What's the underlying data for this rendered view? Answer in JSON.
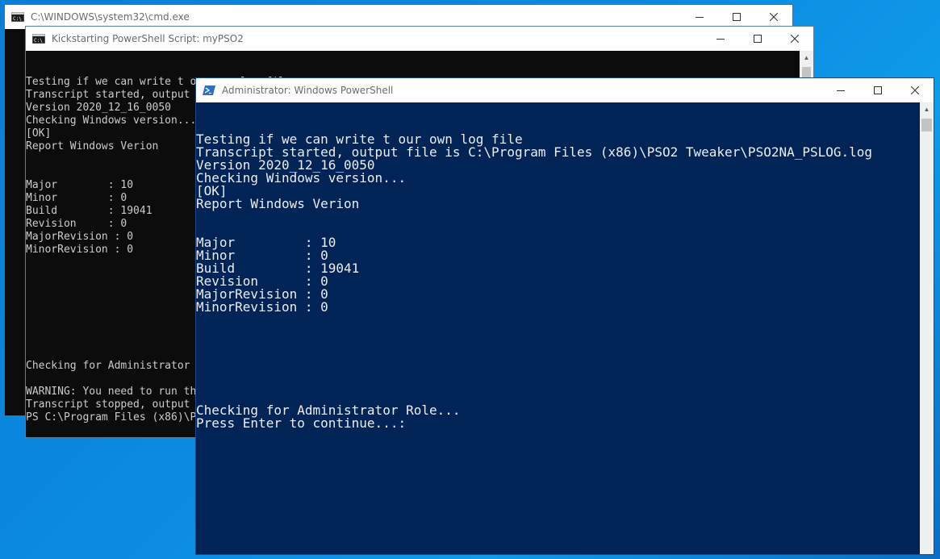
{
  "windows": {
    "cmd": {
      "title": "C:\\WINDOWS\\system32\\cmd.exe"
    },
    "kickstart": {
      "title": "Kickstarting PowerShell Script: myPSO2",
      "lines": [
        "Testing if we can write t our own log file",
        "Transcript started, output file is .\\PSO2NA_PSLOG.log",
        "Version 2020_12_16_0050",
        "Checking Windows version...",
        "[OK]",
        "Report Windows Verion",
        "",
        "",
        "Major        : 10",
        "Minor        : 0",
        "Build        : 19041",
        "Revision     : 0",
        "MajorRevision : 0",
        "MinorRevision : 0",
        "",
        "",
        "",
        "",
        "",
        "",
        "",
        "",
        "Checking for Administrator",
        "",
        "WARNING: You need to run th",
        "Transcript stopped, output",
        "PS C:\\Program Files (x86)\\P"
      ]
    },
    "powershell": {
      "title": "Administrator: Windows PowerShell",
      "lines": [
        "Testing if we can write t our own log file",
        "Transcript started, output file is C:\\Program Files (x86)\\PSO2 Tweaker\\PSO2NA_PSLOG.log",
        "Version 2020_12_16_0050",
        "Checking Windows version...",
        "[OK]",
        "Report Windows Verion",
        "",
        "",
        "Major         : 10",
        "Minor         : 0",
        "Build         : 19041",
        "Revision      : 0",
        "MajorRevision : 0",
        "MinorRevision : 0",
        "",
        "",
        "",
        "",
        "",
        "",
        "",
        "Checking for Administrator Role...",
        "Press Enter to continue...:"
      ]
    }
  },
  "icons": {
    "minimize": "minimize-icon",
    "maximize": "maximize-icon",
    "close": "close-icon",
    "cmd_app": "cmd-app-icon",
    "powershell_app": "powershell-app-icon"
  },
  "colors": {
    "desktop": "#0b8be0",
    "console_black": "#0c0c0c",
    "powershell_blue": "#012456",
    "console_text": "#cccccc",
    "powershell_text": "#eeedf0"
  }
}
